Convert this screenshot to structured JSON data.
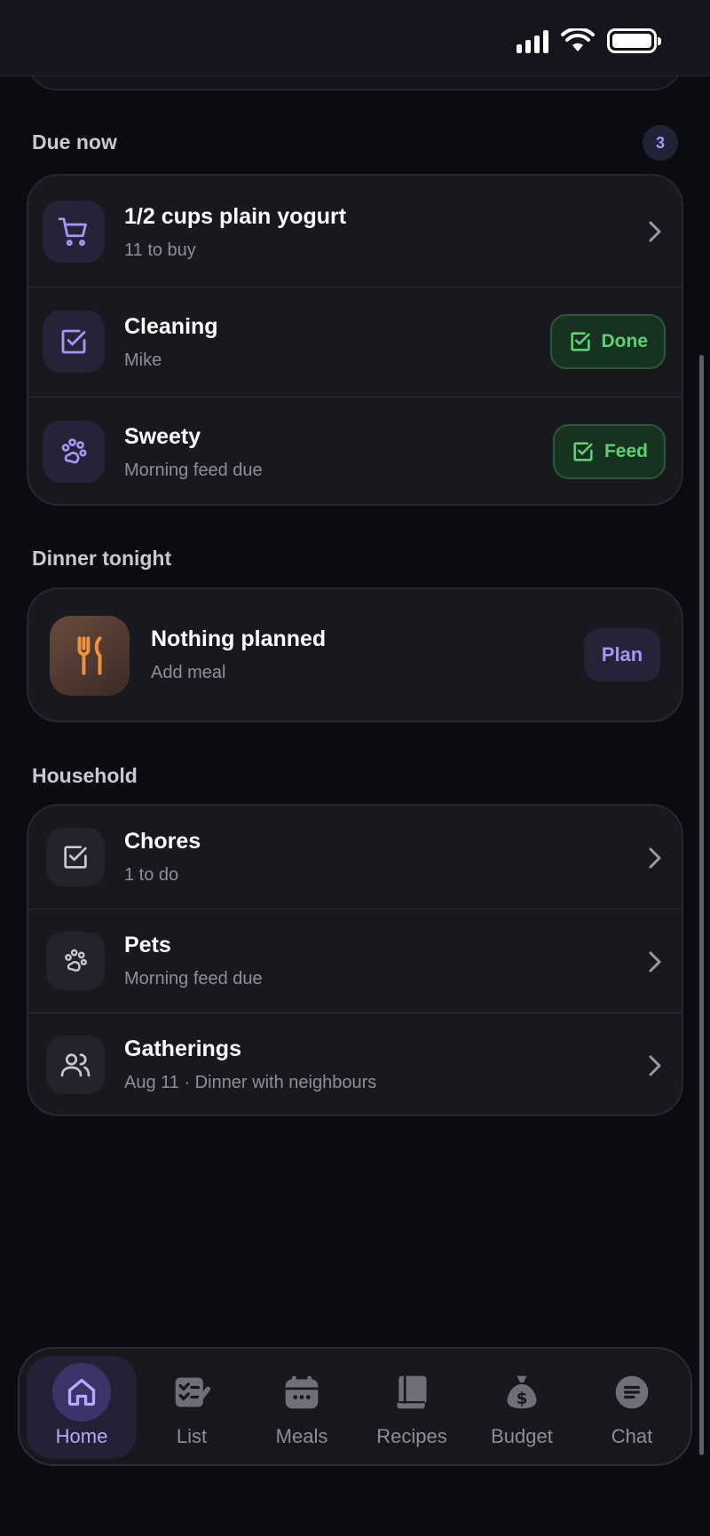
{
  "due_now": {
    "title": "Due now",
    "count": "3",
    "items": [
      {
        "title": "1/2 cups plain yogurt",
        "subtitle": "11 to buy"
      },
      {
        "title": "Cleaning",
        "subtitle": "Mike",
        "action": "Done"
      },
      {
        "title": "Sweety",
        "subtitle": "Morning feed due",
        "action": "Feed"
      }
    ]
  },
  "dinner": {
    "title": "Dinner tonight",
    "meal_title": "Nothing planned",
    "meal_subtitle": "Add meal",
    "plan_label": "Plan"
  },
  "household": {
    "title": "Household",
    "items": [
      {
        "title": "Chores",
        "subtitle": "1 to do"
      },
      {
        "title": "Pets",
        "subtitle": "Morning feed due"
      },
      {
        "title": "Gatherings",
        "subtitle": "Aug 11 · Dinner with neighbours"
      }
    ]
  },
  "tabs": [
    {
      "label": "Home",
      "icon": "home-icon"
    },
    {
      "label": "List",
      "icon": "checklist-icon"
    },
    {
      "label": "Meals",
      "icon": "calendar-icon"
    },
    {
      "label": "Recipes",
      "icon": "book-icon"
    },
    {
      "label": "Budget",
      "icon": "money-bag-icon"
    },
    {
      "label": "Chat",
      "icon": "chat-icon"
    }
  ],
  "colors": {
    "accent": "#a595f5",
    "success": "#5ed174",
    "background": "#0b0b12",
    "card": "#18181f"
  }
}
